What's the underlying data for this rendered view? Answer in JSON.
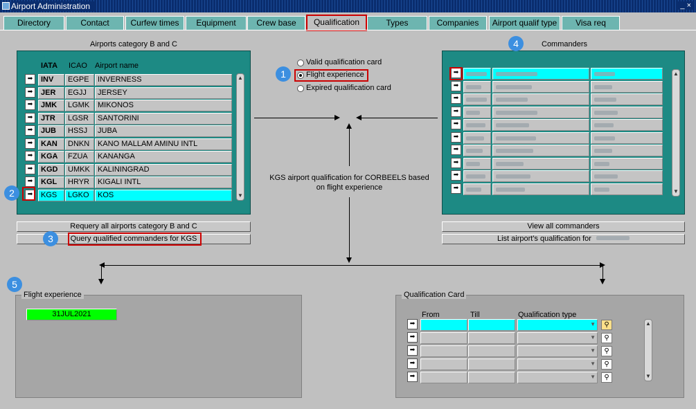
{
  "window": {
    "title": "Airport Administration",
    "controls": "_ ×"
  },
  "tabs": [
    "Directory",
    "Contact",
    "Curfew times",
    "Equipment",
    "Crew base",
    "Qualification",
    "Types",
    "Companies",
    "Airport qualif type",
    "Visa req"
  ],
  "airports": {
    "section_title": "Airports category B and C",
    "headers": {
      "iata": "IATA",
      "icao": "ICAO",
      "name": "Airport name"
    },
    "rows": [
      {
        "iata": "INV",
        "icao": "EGPE",
        "name": "INVERNESS"
      },
      {
        "iata": "JER",
        "icao": "EGJJ",
        "name": "JERSEY"
      },
      {
        "iata": "JMK",
        "icao": "LGMK",
        "name": "MIKONOS"
      },
      {
        "iata": "JTR",
        "icao": "LGSR",
        "name": "SANTORINI"
      },
      {
        "iata": "JUB",
        "icao": "HSSJ",
        "name": "JUBA"
      },
      {
        "iata": "KAN",
        "icao": "DNKN",
        "name": "KANO MALLAM AMINU INTL"
      },
      {
        "iata": "KGA",
        "icao": "FZUA",
        "name": "KANANGA"
      },
      {
        "iata": "KGD",
        "icao": "UMKK",
        "name": "KALININGRAD"
      },
      {
        "iata": "KGL",
        "icao": "HRYR",
        "name": "KIGALI INTL"
      },
      {
        "iata": "KGS",
        "icao": "LGKO",
        "name": "KOS"
      }
    ],
    "selected_index": 9,
    "requery_button": "Requery all airports category B and C",
    "query_button": "Query qualified commanders for KGS"
  },
  "qual_options": {
    "options": [
      "Valid qualification card",
      "Flight experience",
      "Expired qualification card"
    ],
    "selected": "Flight experience"
  },
  "info_text": "KGS airport qualification for CORBEELS based on flight experience",
  "commanders": {
    "section_title": "Commanders",
    "row_count": 10,
    "view_button": "View all commanders",
    "list_button": "List airport's qualification for"
  },
  "flight_experience": {
    "legend": "Flight experience",
    "date": "31JUL2021"
  },
  "qual_card": {
    "legend": "Qualification Card",
    "headers": {
      "from": "From",
      "till": "Till",
      "type": "Qualification type"
    },
    "row_count": 5
  },
  "badges": [
    "1",
    "2",
    "3",
    "4",
    "5"
  ],
  "colors": {
    "teal": "#1d8a84",
    "highlight": "#00ffff",
    "green": "#00ff00",
    "red_box": "#cc0000",
    "badge": "#3c8fe0"
  },
  "icons": {
    "row_select": "row-pointer-icon",
    "scroll": "scrollbar",
    "qual_lookup": "lookup-icon"
  }
}
